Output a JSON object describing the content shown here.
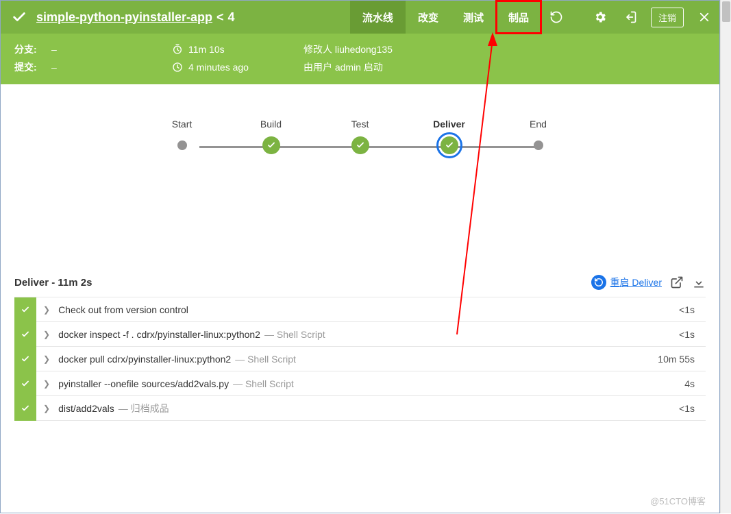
{
  "header": {
    "title": "simple-python-pyinstaller-app",
    "build_sep": "<",
    "build_number": "4",
    "tabs": [
      {
        "label": "流水线",
        "active": true,
        "highlight": false
      },
      {
        "label": "改变",
        "active": false,
        "highlight": false
      },
      {
        "label": "测试",
        "active": false,
        "highlight": false
      },
      {
        "label": "制品",
        "active": false,
        "highlight": true
      }
    ],
    "logout_label": "注销"
  },
  "meta": {
    "branch_label": "分支:",
    "branch_value": "–",
    "commit_label": "提交:",
    "commit_value": "–",
    "duration": "11m 10s",
    "time_ago": "4 minutes ago",
    "author_label": "修改人",
    "author_value": "liuhedong135",
    "started_by": "由用户 admin 启动"
  },
  "pipeline": {
    "nodes": [
      {
        "label": "Start",
        "type": "dot"
      },
      {
        "label": "Build",
        "type": "ok"
      },
      {
        "label": "Test",
        "type": "ok"
      },
      {
        "label": "Deliver",
        "type": "ok",
        "ring": true,
        "bold": true
      },
      {
        "label": "End",
        "type": "dot"
      }
    ]
  },
  "stage": {
    "title": "Deliver - 11m 2s",
    "restart_label": "重启 Deliver",
    "steps": [
      {
        "cmd": "Check out from version control",
        "desc": "",
        "dur": "<1s"
      },
      {
        "cmd": "docker inspect -f . cdrx/pyinstaller-linux:python2",
        "desc": "— Shell Script",
        "dur": "<1s"
      },
      {
        "cmd": "docker pull cdrx/pyinstaller-linux:python2",
        "desc": "— Shell Script",
        "dur": "10m 55s"
      },
      {
        "cmd": "pyinstaller --onefile sources/add2vals.py",
        "desc": "— Shell Script",
        "dur": "4s"
      },
      {
        "cmd": "dist/add2vals",
        "desc": "— 归档成品",
        "dur": "<1s"
      }
    ]
  },
  "watermark": "@51CTO博客"
}
